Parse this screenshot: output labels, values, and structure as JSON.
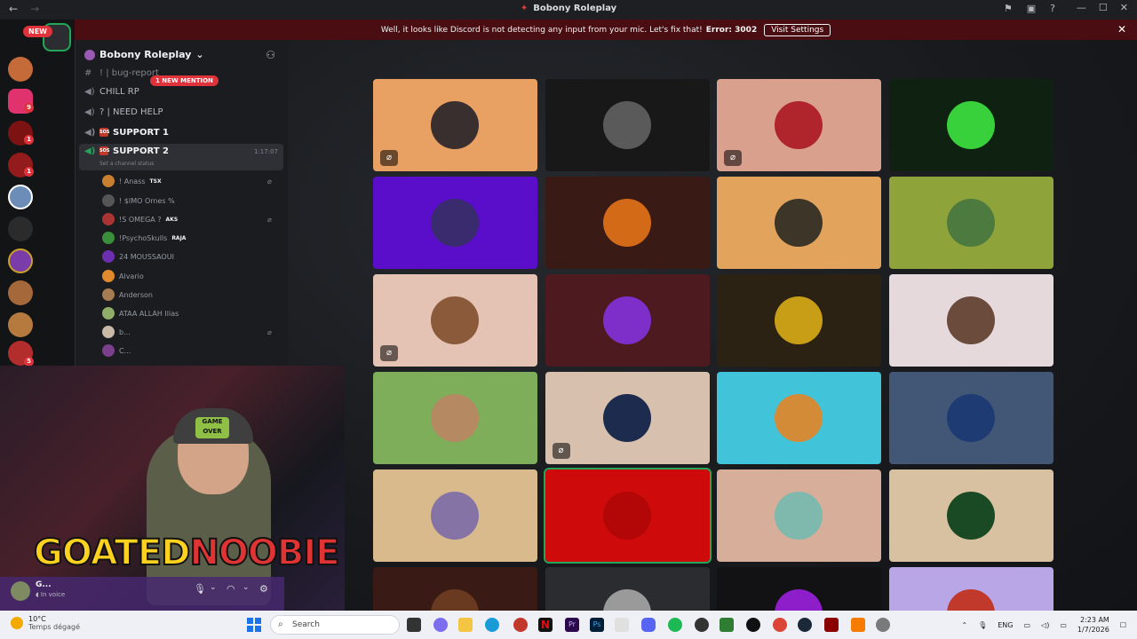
{
  "window": {
    "title": "Bobony Roleplay",
    "back_icon": "arrow-left-icon",
    "forward_icon": "arrow-right-icon"
  },
  "banner": {
    "message": "Well, it looks like Discord is not detecting any input from your mic. Let's fix that!",
    "error": "Error: 3002",
    "button": "Visit Settings"
  },
  "rail": {
    "new_badge": "NEW",
    "pings": [
      "9",
      "1",
      "1",
      "5"
    ]
  },
  "server": {
    "name": "Bobony Roleplay",
    "mention_badge": "1 NEW MENTION",
    "channels": [
      {
        "name": "! | bug-report",
        "type": "text"
      },
      {
        "name": "CHILL RP",
        "type": "voice"
      },
      {
        "name": "? | NEED HELP",
        "type": "voice"
      },
      {
        "name": "SUPPORT 1",
        "type": "voice-tag"
      }
    ],
    "active_channel": {
      "name": "SUPPORT 2",
      "timer": "1:17:07",
      "status": "Set a channel status"
    },
    "members": [
      {
        "name": "! Anass",
        "tag": "TSX",
        "muted": true,
        "color": "#c7802f"
      },
      {
        "name": "! $IMO Ornes %",
        "tag": "",
        "muted": false,
        "color": "#555"
      },
      {
        "name": "!S OMEGA ?",
        "tag": "AKS",
        "muted": true,
        "color": "#a33"
      },
      {
        "name": "!PsychoSkulls",
        "tag": "RAJA",
        "muted": false,
        "color": "#3a8f3a"
      },
      {
        "name": "24 MOUSSAOUI",
        "tag": "",
        "muted": false,
        "color": "#6c2fb0"
      },
      {
        "name": "Alvario",
        "tag": "",
        "muted": false,
        "color": "#e08a2e"
      },
      {
        "name": "Anderson",
        "tag": "",
        "muted": false,
        "color": "#a67c52"
      },
      {
        "name": "ATAA ALLAH Ilias",
        "tag": "",
        "muted": false,
        "color": "#8fae6a"
      },
      {
        "name": "b...",
        "tag": "",
        "muted": true,
        "color": "#c9b8a6"
      },
      {
        "name": "C...",
        "tag": "",
        "muted": false,
        "color": "#7b3f8c"
      }
    ]
  },
  "streamer": {
    "brand_a": "GOATED",
    "brand_b": "NOOBIE",
    "cap_text": "GAME OVER"
  },
  "user": {
    "name": "G...",
    "status": "In voice"
  },
  "tiles": [
    {
      "bg": "#e8a063",
      "av": "#3a2f2f",
      "muted": true,
      "speaking": false
    },
    {
      "bg": "#181818",
      "av": "#5a5a5a",
      "muted": false,
      "speaking": false
    },
    {
      "bg": "#d9a08e",
      "av": "#b0242b",
      "muted": true,
      "speaking": false
    },
    {
      "bg": "#0f2212",
      "av": "#39d13b",
      "muted": false,
      "speaking": false
    },
    {
      "bg": "#5a0ec9",
      "av": "#3a2a6e",
      "muted": false,
      "speaking": false
    },
    {
      "bg": "#3a1a14",
      "av": "#d26a18",
      "muted": false,
      "speaking": false
    },
    {
      "bg": "#e2a35c",
      "av": "#3d3528",
      "muted": false,
      "speaking": false
    },
    {
      "bg": "#8ea43a",
      "av": "#4d7a3e",
      "muted": false,
      "speaking": false
    },
    {
      "bg": "#e4c2b4",
      "av": "#8a5a3b",
      "muted": true,
      "speaking": false
    },
    {
      "bg": "#4d1a20",
      "av": "#7e2ec9",
      "muted": false,
      "speaking": false
    },
    {
      "bg": "#2c2214",
      "av": "#c79e15",
      "muted": false,
      "speaking": false
    },
    {
      "bg": "#e5d9dc",
      "av": "#6a4b3c",
      "muted": false,
      "speaking": false
    },
    {
      "bg": "#7fae5b",
      "av": "#b58a62",
      "muted": false,
      "speaking": false
    },
    {
      "bg": "#d7c1ae",
      "av": "#1d2c4e",
      "muted": true,
      "speaking": false
    },
    {
      "bg": "#41c4d9",
      "av": "#d38b37",
      "muted": false,
      "speaking": false
    },
    {
      "bg": "#425676",
      "av": "#1f3b73",
      "muted": false,
      "speaking": false
    },
    {
      "bg": "#d9ba8d",
      "av": "#8573a6",
      "muted": false,
      "speaking": false
    },
    {
      "bg": "#cf0a0a",
      "av": "#b30606",
      "muted": false,
      "speaking": true
    },
    {
      "bg": "#d6ae99",
      "av": "#7fb8ad",
      "muted": false,
      "speaking": false
    },
    {
      "bg": "#d8c1a0",
      "av": "#1a4a24",
      "muted": false,
      "speaking": false
    },
    {
      "bg": "#3a1a14",
      "av": "#6a3a20",
      "muted": false,
      "speaking": false
    },
    {
      "bg": "#2a2c30",
      "av": "#9a9a9a",
      "muted": false,
      "speaking": false
    },
    {
      "bg": "#121214",
      "av": "#8e1ec9",
      "muted": false,
      "speaking": false
    },
    {
      "bg": "#b8a6e6",
      "av": "#c0392b",
      "muted": false,
      "speaking": false
    }
  ],
  "taskbar": {
    "temp": "10°C",
    "weather": "Temps dégagé",
    "search_placeholder": "Search",
    "lang": "ENG",
    "time": "2:23 AM",
    "date": "1/7/2026"
  }
}
